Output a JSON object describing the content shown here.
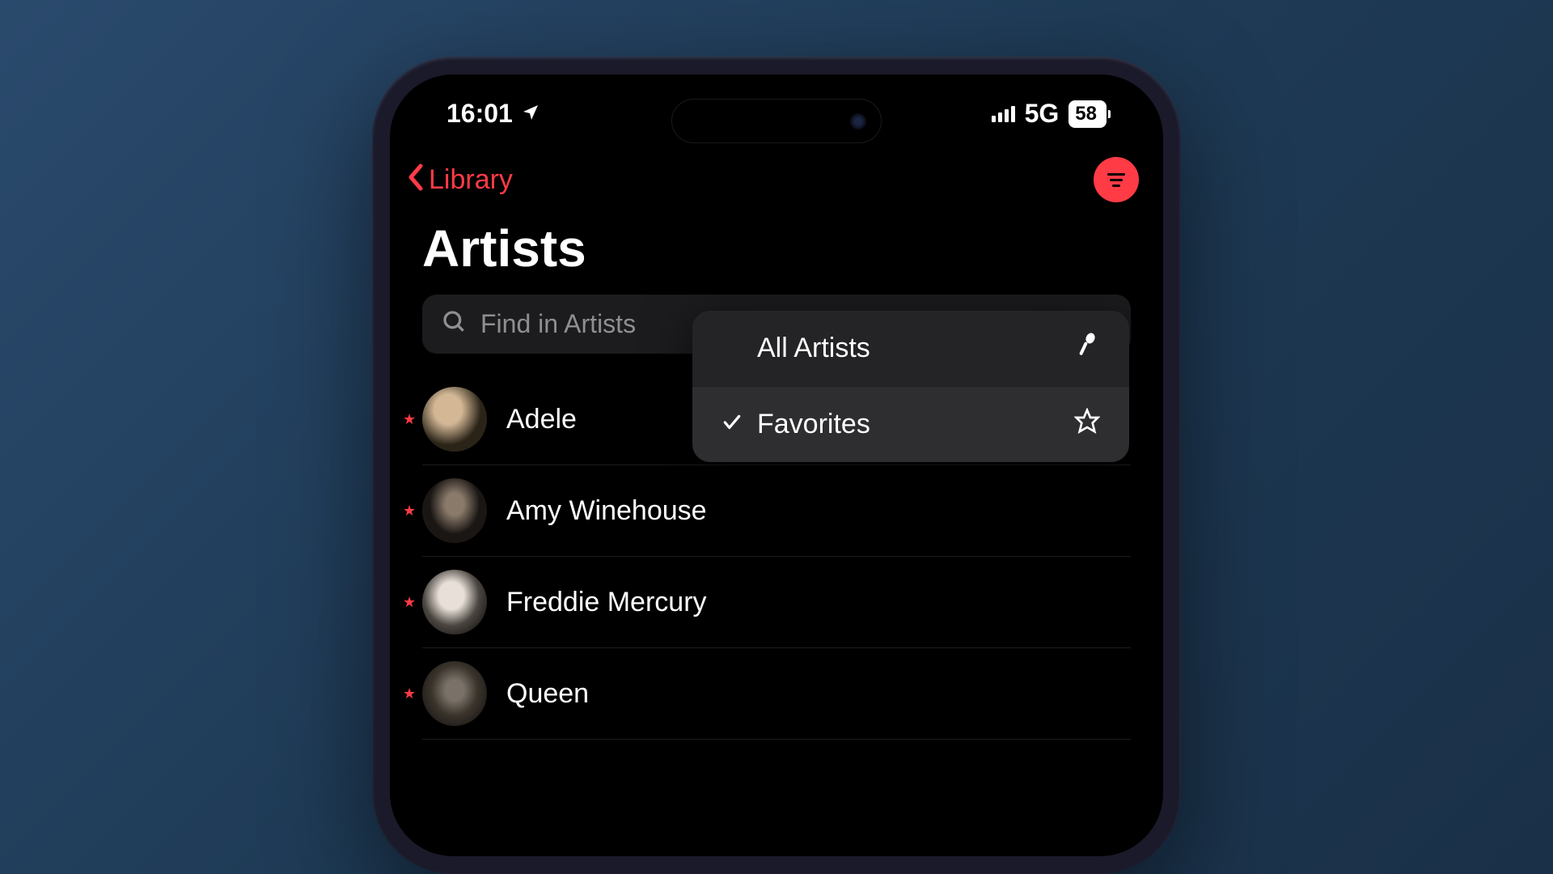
{
  "statusBar": {
    "time": "16:01",
    "network": "5G",
    "battery": "58"
  },
  "nav": {
    "back": "Library"
  },
  "title": "Artists",
  "search": {
    "placeholder": "Find in Artists"
  },
  "dropdown": {
    "items": [
      {
        "label": "All Artists",
        "checked": false,
        "icon": "mic"
      },
      {
        "label": "Favorites",
        "checked": true,
        "icon": "star"
      }
    ]
  },
  "artists": [
    {
      "name": "Adele",
      "favorite": true
    },
    {
      "name": "Amy Winehouse",
      "favorite": true
    },
    {
      "name": "Freddie Mercury",
      "favorite": true
    },
    {
      "name": "Queen",
      "favorite": true
    }
  ]
}
